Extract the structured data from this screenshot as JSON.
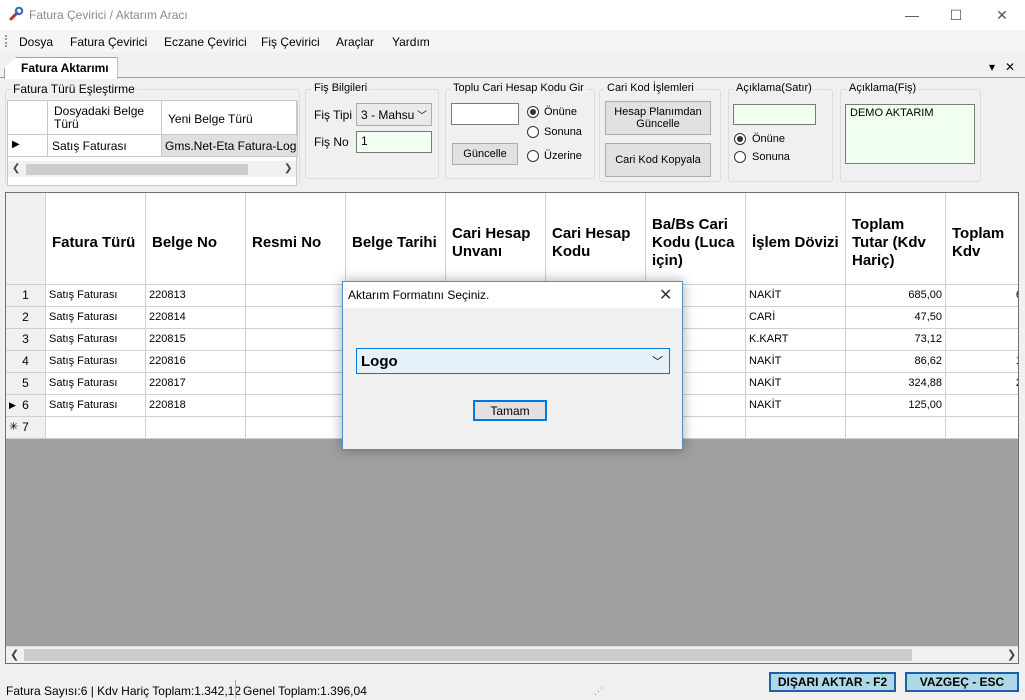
{
  "window": {
    "title": "Fatura Çevirici / Aktarım Aracı",
    "minimize": "—",
    "maximize": "☐",
    "close": "✕"
  },
  "menu": [
    "Dosya",
    "Fatura Çevirici",
    "Eczane Çevirici",
    "Fiş Çevirici",
    "Araçlar",
    "Yardım"
  ],
  "tab": {
    "label": "Fatura Aktarımı",
    "dropdown": "▾",
    "close": "✕"
  },
  "fatura_turu": {
    "legend": "Fatura Türü Eşleştirme",
    "col1": "Dosyadaki Belge Türü",
    "col2": "Yeni Belge Türü",
    "row_source": "Satış Faturası",
    "row_target": "Gms.Net-Eta Fatura-Log"
  },
  "fis_bilgileri": {
    "legend": "Fiş Bilgileri",
    "tipi_label": "Fiş Tipi",
    "tipi_value": "3 - Mahsu",
    "no_label": "Fiş No",
    "no_value": "1"
  },
  "toplu": {
    "legend": "Toplu Cari Hesap Kodu Gir",
    "input": "",
    "button": "Güncelle",
    "opt1": "Önüne",
    "opt2": "Sonuna",
    "opt3": "Üzerine",
    "selected": "Önüne"
  },
  "cari_kod": {
    "legend": "Cari Kod İşlemleri",
    "btn1": "Hesap Planımdan Güncelle",
    "btn2": "Cari Kod Kopyala"
  },
  "aciklama_satir": {
    "legend": "Açıklama(Satır)",
    "input": "",
    "opt1": "Önüne",
    "opt2": "Sonuna",
    "selected": "Önüne"
  },
  "aciklama_fis": {
    "legend": "Açıklama(Fiş)",
    "value": "DEMO AKTARIM"
  },
  "grid": {
    "columns": [
      "Fatura Türü",
      "Belge No",
      "Resmi No",
      "Belge Tarihi",
      "Cari Hesap Unvanı",
      "Cari Hesap Kodu",
      "Ba/Bs Cari Kodu (Luca için)",
      "İşlem Dövizi",
      "Toplam Tutar (Kdv Hariç)",
      "Toplam Kdv"
    ],
    "rows": [
      {
        "n": "1",
        "tur": "Satış Faturası",
        "belge": "220813",
        "doviz": "NAKİT",
        "tutar": "685,00",
        "kdv": "6"
      },
      {
        "n": "2",
        "tur": "Satış Faturası",
        "belge": "220814",
        "doviz": "CARİ",
        "tutar": "47,50",
        "kdv": ""
      },
      {
        "n": "3",
        "tur": "Satış Faturası",
        "belge": "220815",
        "doviz": "K.KART",
        "tutar": "73,12",
        "kdv": ""
      },
      {
        "n": "4",
        "tur": "Satış Faturası",
        "belge": "220816",
        "doviz": "NAKİT",
        "tutar": "86,62",
        "kdv": "1"
      },
      {
        "n": "5",
        "tur": "Satış Faturası",
        "belge": "220817",
        "doviz": "NAKİT",
        "tutar": "324,88",
        "kdv": "2"
      },
      {
        "n": "6",
        "tur": "Satış Faturası",
        "belge": "220818",
        "doviz": "NAKİT",
        "tutar": "125,00",
        "kdv": "("
      }
    ],
    "new_row": "7"
  },
  "status": {
    "fatura": "Fatura Sayısı:6 | Kdv Hariç Toplam:1.342,12",
    "genel": "Genel Toplam:1.396,04"
  },
  "actions": {
    "export": "DIŞARI AKTAR - F2",
    "cancel": "VAZGEÇ - ESC"
  },
  "dialog": {
    "title": "Aktarım Formatını Seçiniz.",
    "selected": "Logo",
    "ok": "Tamam"
  }
}
